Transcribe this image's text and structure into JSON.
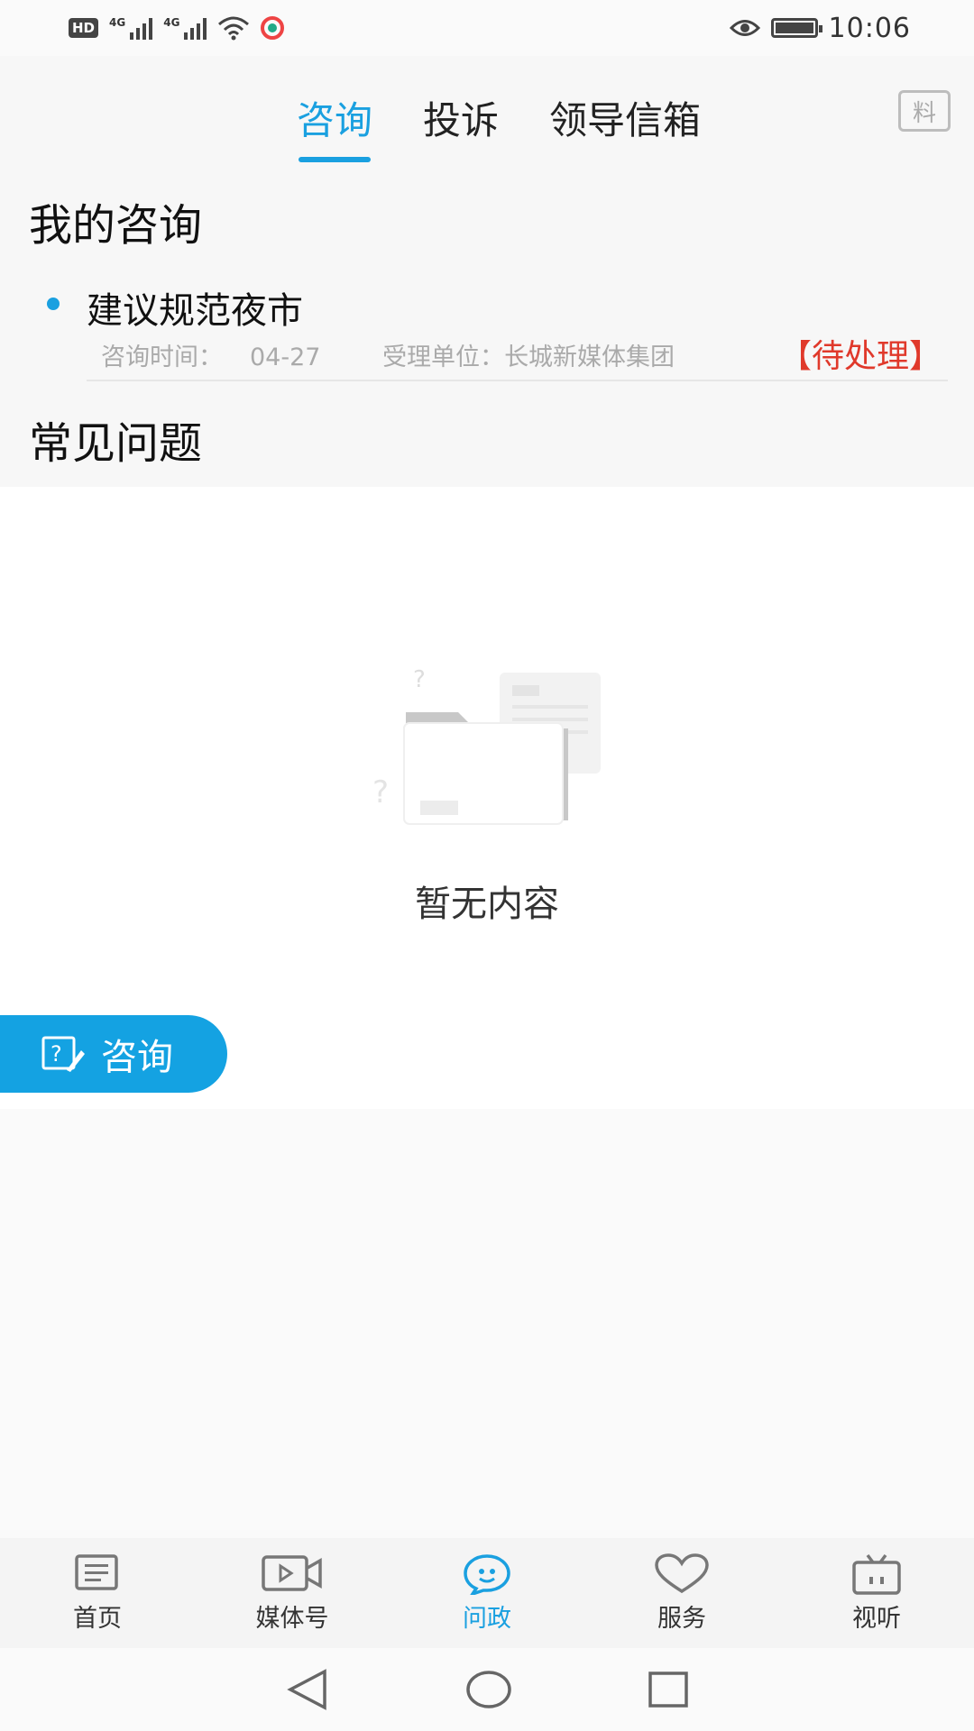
{
  "status_bar": {
    "time": "10:06",
    "hd_label": "HD",
    "network_label": "4G"
  },
  "top_tabs": [
    {
      "label": "咨询",
      "active": true
    },
    {
      "label": "投诉",
      "active": false
    },
    {
      "label": "领导信箱",
      "active": false
    }
  ],
  "tip_icon_label": "料",
  "my_consult": {
    "title": "我的咨询",
    "items": [
      {
        "title": "建议规范夜市",
        "time_label": "咨询时间：",
        "time_value": "04-27",
        "unit_label": "受理单位：",
        "unit_value": "长城新媒体集团",
        "status": "【待处理】"
      }
    ]
  },
  "faq": {
    "title": "常见问题",
    "empty_text": "暂无内容"
  },
  "fab": {
    "label": "咨询"
  },
  "bottom_nav": [
    {
      "label": "首页",
      "icon": "news-icon",
      "active": false
    },
    {
      "label": "媒体号",
      "icon": "video-icon",
      "active": false
    },
    {
      "label": "问政",
      "icon": "chat-icon",
      "active": true
    },
    {
      "label": "服务",
      "icon": "heart-icon",
      "active": false
    },
    {
      "label": "视听",
      "icon": "tv-icon",
      "active": false
    }
  ],
  "colors": {
    "accent": "#1aa0e0",
    "status_red": "#e0392b"
  }
}
